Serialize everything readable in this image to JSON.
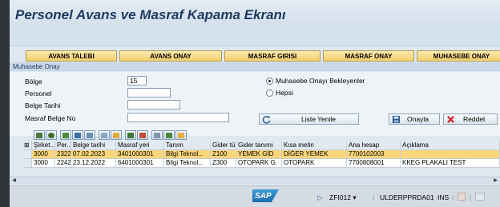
{
  "title": "Personel Avans ve Masraf Kapama Ekranı",
  "tabs": [
    "AVANS TALEBI",
    "AVANS ONAY",
    "MASRAF GIRISI",
    "MASRAF ONAY",
    "MUHASEBE ONAY"
  ],
  "section_title": "Muhasebe Onay",
  "form": {
    "bolge_label": "Bölge",
    "bolge_value": "15",
    "personel_label": "Personel",
    "belge_tarihi_label": "Belge Tarihi",
    "masraf_belge_label": "Masraf Belge No",
    "radio_1": "Muhasebe Onayı Bekleyenler",
    "radio_2": "Hepsi",
    "liste_yenile": "Liste Yenile",
    "onayla": "Onayla",
    "reddet": "Reddet"
  },
  "grid": {
    "columns": [
      "Şirket...",
      "Per...",
      "Belge tarihi",
      "Masraf yeri",
      "Tanım",
      "Gider türü",
      "Gider tanımı",
      "Kısa metin",
      "Ana hesap",
      "Açıklama"
    ],
    "rows": [
      [
        "3000",
        "2322",
        "07.02.2023",
        "3401000301",
        "Bilgi Teknol...",
        "Z100",
        "YEMEK GİD",
        "DİĞER YEMEK",
        "7700102003",
        ""
      ],
      [
        "3000",
        "2242",
        "23.12.2022",
        "6401000301",
        "Bilgi Teknol...",
        "Z300",
        "OTOPARK G.",
        "OTOPARK",
        "7700808001",
        "KKEG PLAKALI TEST"
      ]
    ]
  },
  "statusbar": {
    "logo": "SAP",
    "transaction": "ZFI012",
    "server": "ULDERPPRDA01",
    "mode": "INS"
  },
  "colors": {
    "title": "#1f3a5f",
    "selected_row": "#fcd67a",
    "tab_bg": "#f2cf6c"
  }
}
